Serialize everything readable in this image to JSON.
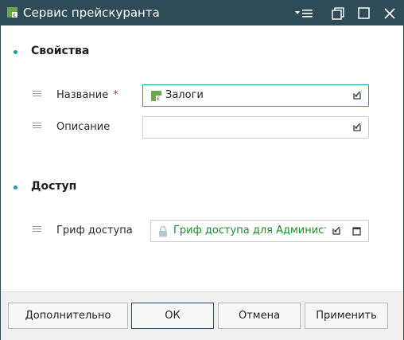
{
  "window": {
    "title": "Сервис прейскуранта"
  },
  "sections": {
    "properties": {
      "title": "Свойства"
    },
    "access": {
      "title": "Доступ"
    }
  },
  "fields": {
    "name": {
      "label": "Название",
      "required_mark": "*",
      "value": "Залоги"
    },
    "description": {
      "label": "Описание",
      "value": ""
    },
    "access_stamp": {
      "label": "Гриф доступа",
      "value": "Гриф доступа для Администрат"
    }
  },
  "buttons": {
    "more": "Дополнительно",
    "ok": "ОК",
    "cancel": "Отмена",
    "apply": "Применить"
  },
  "colors": {
    "titlebar": "#2f4b57",
    "accent": "#18a0a8",
    "link": "#1f8a2e",
    "required": "#d02b2b"
  }
}
